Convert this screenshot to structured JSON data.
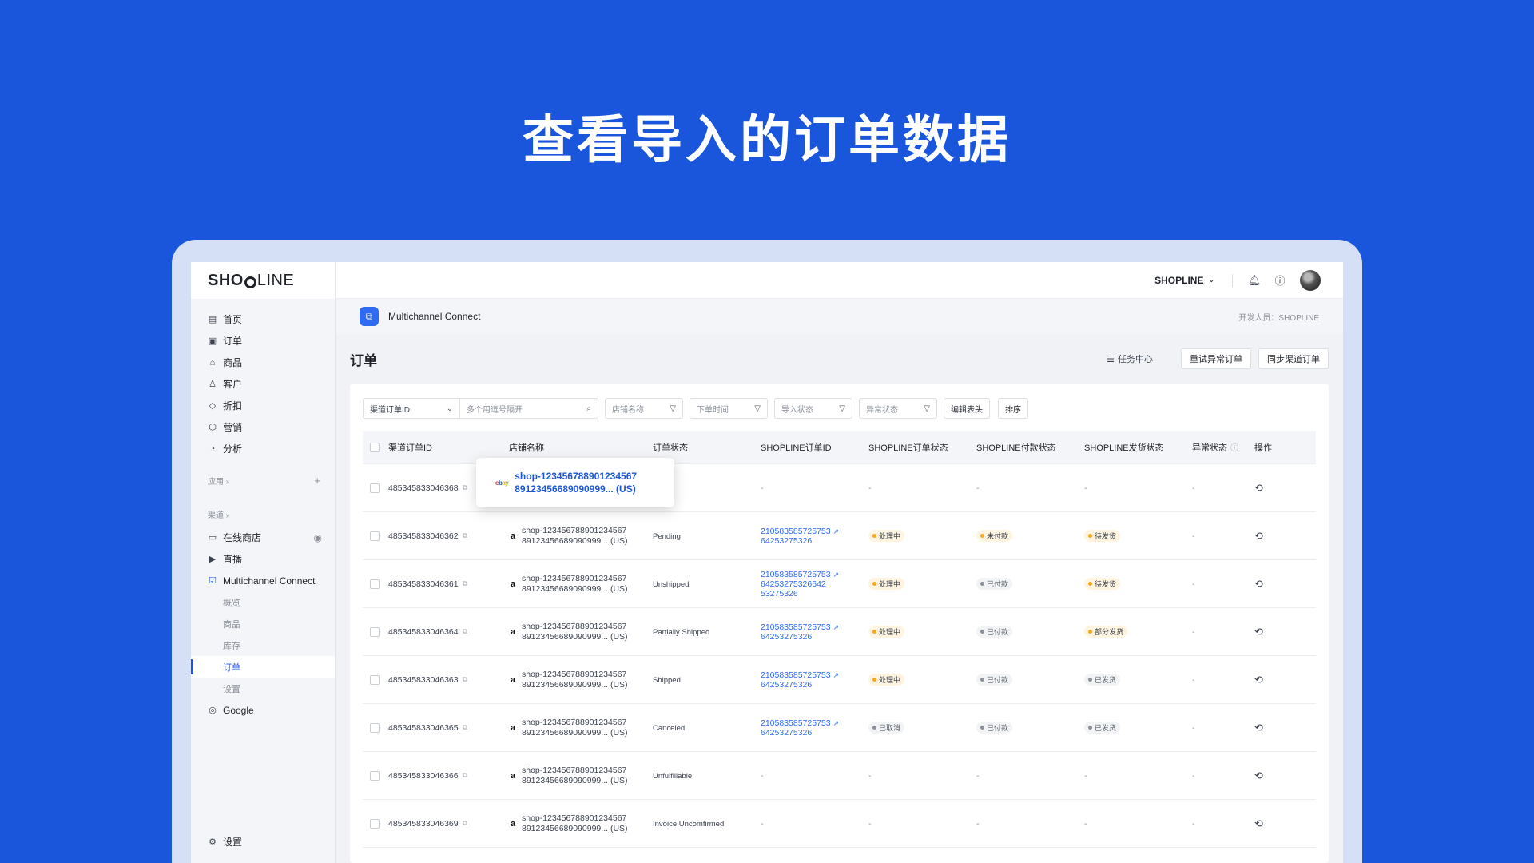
{
  "hero": {
    "title": "查看导入的订单数据"
  },
  "sidebar": {
    "logo_bold": "SHO",
    "logo_light": "LINE",
    "main_items": [
      {
        "label": "首页",
        "icon": "home-icon"
      },
      {
        "label": "订单",
        "icon": "order-icon"
      },
      {
        "label": "商品",
        "icon": "bag-icon"
      },
      {
        "label": "客户",
        "icon": "user-icon"
      },
      {
        "label": "折扣",
        "icon": "tag-icon"
      },
      {
        "label": "营销",
        "icon": "marketing-icon"
      },
      {
        "label": "分析",
        "icon": "chart-icon"
      }
    ],
    "apps_label": "应用",
    "channels_label": "渠道",
    "channel_items": {
      "online_store": "在线商店",
      "live": "直播",
      "multichannel": "Multichannel Connect",
      "overview": "概览",
      "products": "商品",
      "inventory": "库存",
      "orders": "订单",
      "settings_sub": "设置",
      "google": "Google"
    },
    "settings": "设置"
  },
  "topbar": {
    "store_name": "SHOPLINE"
  },
  "appbar": {
    "app_name": "Multichannel Connect",
    "developer": "开发人员：SHOPLINE"
  },
  "page": {
    "title": "订单",
    "task_center": "任务中心",
    "retry_button": "重试异常订单",
    "sync_button": "同步渠道订单"
  },
  "filters": {
    "channel_order_id": "渠道订单ID",
    "search_placeholder": "多个用逗号隔开",
    "store_name": "店铺名称",
    "order_time": "下单时间",
    "import_status": "导入状态",
    "abnormal_status": "异常状态",
    "edit_header": "编辑表头",
    "sort": "排序"
  },
  "table": {
    "headers": {
      "channel_order_id": "渠道订单ID",
      "store_name": "店铺名称",
      "order_status": "订单状态",
      "shopline_order_id": "SHOPLINE订单ID",
      "shopline_order_status": "SHOPLINE订单状态",
      "shopline_pay_status": "SHOPLINE付款状态",
      "shopline_ship_status": "SHOPLINE发货状态",
      "abnormal_status": "异常状态",
      "operation": "操作"
    },
    "tooltip": {
      "line1": "shop-123456788901234567",
      "line2": "89123456689090999... (US)"
    },
    "rows": [
      {
        "id": "485345833046368",
        "store1": "",
        "store2": "",
        "status": "",
        "sid1": "-",
        "sid2": "",
        "sid3": "",
        "sos": "-",
        "spay": "-",
        "sship": "-",
        "abn": "-"
      },
      {
        "id": "485345833046362",
        "store1": "shop-123456788901234567",
        "store2": "89123456689090999... (US)",
        "status": "Pending",
        "sid1": "210583585725753",
        "sid2": "64253275326",
        "sid3": "",
        "sos": "处理中",
        "spay": "未付款",
        "sship": "待发货",
        "abn": "-"
      },
      {
        "id": "485345833046361",
        "store1": "shop-123456788901234567",
        "store2": "89123456689090999... (US)",
        "status": "Unshipped",
        "sid1": "210583585725753",
        "sid2": "64253275326642",
        "sid3": "53275326",
        "sos": "处理中",
        "spay": "已付款",
        "sship": "待发货",
        "abn": "-"
      },
      {
        "id": "485345833046364",
        "store1": "shop-123456788901234567",
        "store2": "89123456689090999... (US)",
        "status": "Partially Shipped",
        "sid1": "210583585725753",
        "sid2": "64253275326",
        "sid3": "",
        "sos": "处理中",
        "spay": "已付款",
        "sship": "部分发货",
        "abn": "-"
      },
      {
        "id": "485345833046363",
        "store1": "shop-123456788901234567",
        "store2": "89123456689090999... (US)",
        "status": "Shipped",
        "sid1": "210583585725753",
        "sid2": "64253275326",
        "sid3": "",
        "sos": "处理中",
        "spay": "已付款",
        "sship": "已发货",
        "abn": "-"
      },
      {
        "id": "485345833046365",
        "store1": "shop-123456788901234567",
        "store2": "89123456689090999... (US)",
        "status": "Canceled",
        "sid1": "210583585725753",
        "sid2": "64253275326",
        "sid3": "",
        "sos": "已取消",
        "spay": "已付款",
        "sship": "已发货",
        "abn": "-"
      },
      {
        "id": "485345833046366",
        "store1": "shop-123456788901234567",
        "store2": "89123456689090999... (US)",
        "status": "Unfulfillable",
        "sid1": "-",
        "sid2": "",
        "sid3": "",
        "sos": "-",
        "spay": "-",
        "sship": "-",
        "abn": "-"
      },
      {
        "id": "485345833046369",
        "store1": "shop-123456788901234567",
        "store2": "89123456689090999... (US)",
        "status": "Invoice Uncomfirmed",
        "sid1": "-",
        "sid2": "",
        "sid3": "",
        "sos": "-",
        "spay": "-",
        "sship": "-",
        "abn": "-"
      }
    ]
  },
  "colors": {
    "brand_blue": "#1a56db",
    "link_blue": "#2f6bf0",
    "warn_orange": "#f5a623"
  }
}
